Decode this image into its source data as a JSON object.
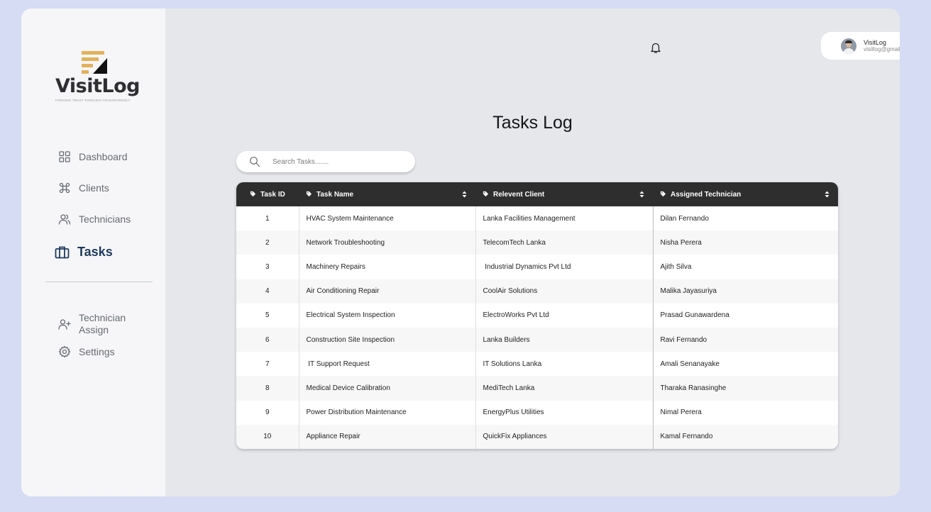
{
  "brand": {
    "name": "VisitLog",
    "tagline": "FORGING TRUST THROUGH TRANSPARENCY"
  },
  "sidebar": {
    "items": [
      {
        "label": "Dashboard",
        "icon": "grid-icon"
      },
      {
        "label": "Clients",
        "icon": "command-icon"
      },
      {
        "label": "Technicians",
        "icon": "users-icon"
      },
      {
        "label": "Tasks",
        "icon": "briefcase-icon",
        "active": true
      }
    ],
    "secondary": [
      {
        "label": "Technician Assign",
        "icon": "user-plus-icon"
      },
      {
        "label": "Settings",
        "icon": "gear-icon"
      }
    ]
  },
  "header": {
    "notification_icon": "bell-icon",
    "user": {
      "name": "VisitLog",
      "email": "visitlog@gmail.com"
    }
  },
  "page": {
    "title": "Tasks Log"
  },
  "search": {
    "placeholder": "Search Tasks......."
  },
  "table": {
    "columns": [
      "Task ID",
      "Task Name",
      "Relevent Client",
      "Assigned Technician"
    ],
    "rows": [
      [
        "1",
        "HVAC System Maintenance",
        "Lanka Facilities Management",
        "Dilan Fernando"
      ],
      [
        "2",
        "Network Troubleshooting",
        "TelecomTech Lanka",
        "Nisha Perera"
      ],
      [
        "3",
        "Machinery Repairs",
        " Industrial Dynamics Pvt Ltd",
        "Ajith Silva"
      ],
      [
        "4",
        "Air Conditioning Repair",
        "CoolAir Solutions",
        "Malika Jayasuriya"
      ],
      [
        "5",
        "Electrical System Inspection",
        "ElectroWorks Pvt Ltd",
        "Prasad Gunawardena"
      ],
      [
        "6",
        "Construction Site Inspection",
        "Lanka Builders",
        "Ravi Fernando"
      ],
      [
        "7",
        " IT Support Request",
        "IT Solutions Lanka",
        "Amali Senanayake"
      ],
      [
        "8",
        "Medical Device Calibration",
        "MediTech Lanka",
        "Tharaka Ranasinghe"
      ],
      [
        "9",
        "Power Distribution Maintenance",
        "EnergyPlus Utilities",
        "Nimal Perera"
      ],
      [
        "10",
        "Appliance Repair",
        "QuickFix Appliances",
        "Kamal Fernando"
      ]
    ]
  },
  "colors": {
    "page_bg": "#d5dcf3",
    "sidebar_bg": "#f6f6f8",
    "main_bg": "#e6e7eb",
    "table_header_bg": "#2e2e2e",
    "active_nav": "#1e3a5f",
    "logo_gold": "#e2b25a"
  }
}
